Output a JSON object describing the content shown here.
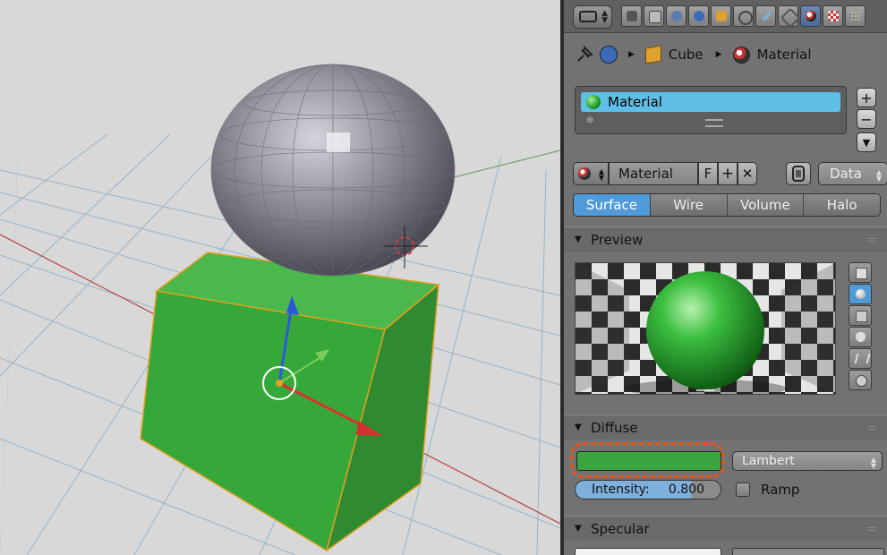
{
  "header": {
    "tabs": [
      "render",
      "render-layers",
      "scene",
      "world",
      "object",
      "constraints",
      "modifiers",
      "data",
      "material",
      "texture",
      "particles"
    ],
    "active_tab": "material"
  },
  "breadcrumb": {
    "object": "Cube",
    "material": "Material"
  },
  "material_slots": {
    "items": [
      "Material"
    ],
    "selected": "Material"
  },
  "datablock": {
    "name": "Material",
    "fake_user": "F",
    "link": "Data"
  },
  "type_tabs": {
    "items": [
      "Surface",
      "Wire",
      "Volume",
      "Halo"
    ],
    "active": "Surface"
  },
  "preview": {
    "title": "Preview",
    "shapes": [
      "plane",
      "sphere",
      "cube",
      "monkey",
      "hair",
      "sphere-sky"
    ],
    "active_shape": "sphere"
  },
  "diffuse": {
    "title": "Diffuse",
    "color": "#3ca540",
    "shader": "Lambert",
    "intensity_label": "Intensity:",
    "intensity_value": "0.800",
    "ramp_label": "Ramp"
  },
  "specular": {
    "title": "Specular"
  },
  "colors": {
    "selected_blue": "#5fbfe6",
    "active_tab_blue": "#4f9ad8",
    "highlight_outline": "#e8541e",
    "cube_green": "#3aa63c"
  }
}
